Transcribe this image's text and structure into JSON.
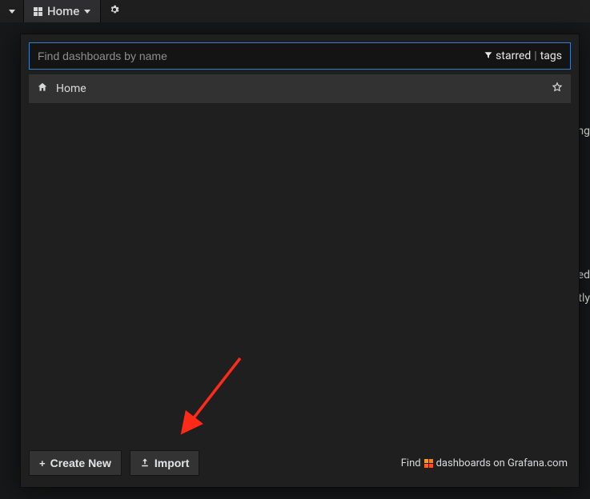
{
  "topbar": {
    "current_dashboard": "Home"
  },
  "search": {
    "placeholder": "Find dashboards by name",
    "starred_label": "starred",
    "tags_label": "tags"
  },
  "dashboards": [
    {
      "name": "Home"
    }
  ],
  "buttons": {
    "create_new": "Create New",
    "import": "Import"
  },
  "footer": {
    "find_prefix": "Find",
    "find_suffix": "dashboards on Grafana.com"
  },
  "side_fragments": {
    "ing": "ing",
    "red": "red",
    "ntly": "ntly"
  }
}
